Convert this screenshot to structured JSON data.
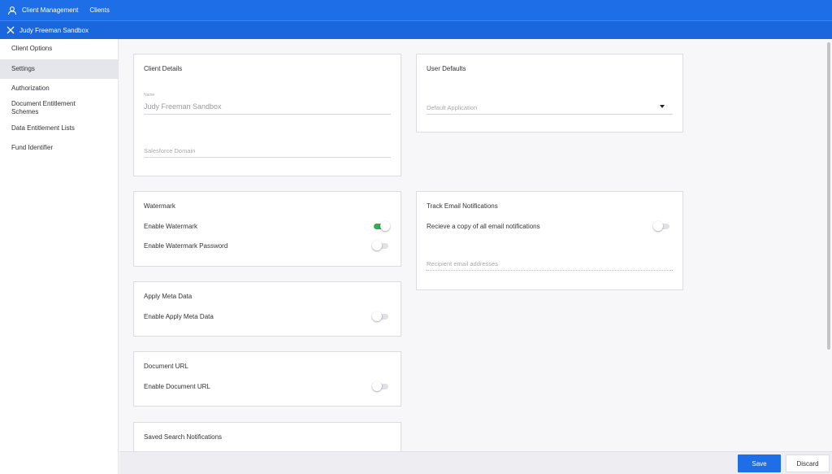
{
  "topbar": {
    "crumbs": [
      "Client Management",
      "Clients"
    ],
    "icon": "user-icon",
    "color": "#1e6ee8"
  },
  "subbar": {
    "title": "Judy Freeman Sandbox",
    "icon": "close-icon"
  },
  "sidebar": {
    "items": [
      {
        "label": "Client Options",
        "active": false
      },
      {
        "label": "Settings",
        "active": true
      },
      {
        "label": "Authorization",
        "active": false
      },
      {
        "label": "Document Entitlement Schemes",
        "active": false
      },
      {
        "label": "Data Entitlement Lists",
        "active": false
      },
      {
        "label": "Fund Identifier",
        "active": false
      }
    ]
  },
  "client_details": {
    "title": "Client Details",
    "name_label": "Name",
    "name_value": "Judy Freeman Sandbox",
    "salesforce_placeholder": "Salesforce Domain"
  },
  "user_defaults": {
    "title": "User Defaults",
    "default_app_placeholder": "Default Application"
  },
  "watermark": {
    "title": "Watermark",
    "enable_label": "Enable Watermark",
    "enable_on": true,
    "password_label": "Enable Watermark Password",
    "password_on": false
  },
  "track_email": {
    "title": "Track Email Notifications",
    "copy_label": "Recieve a copy of all email notifications",
    "copy_on": false,
    "recipient_placeholder": "Recipient email addresses"
  },
  "meta_data": {
    "title": "Apply Meta Data",
    "enable_label": "Enable Apply Meta Data",
    "enable_on": false
  },
  "document_url": {
    "title": "Document URL",
    "enable_label": "Enable Document URL",
    "enable_on": false
  },
  "saved_search": {
    "title": "Saved Search Notifications"
  },
  "footer": {
    "save_label": "Save",
    "discard_label": "Discard"
  },
  "colors": {
    "primary": "#1e6ee8",
    "toggle_on": "#2bb24c"
  }
}
